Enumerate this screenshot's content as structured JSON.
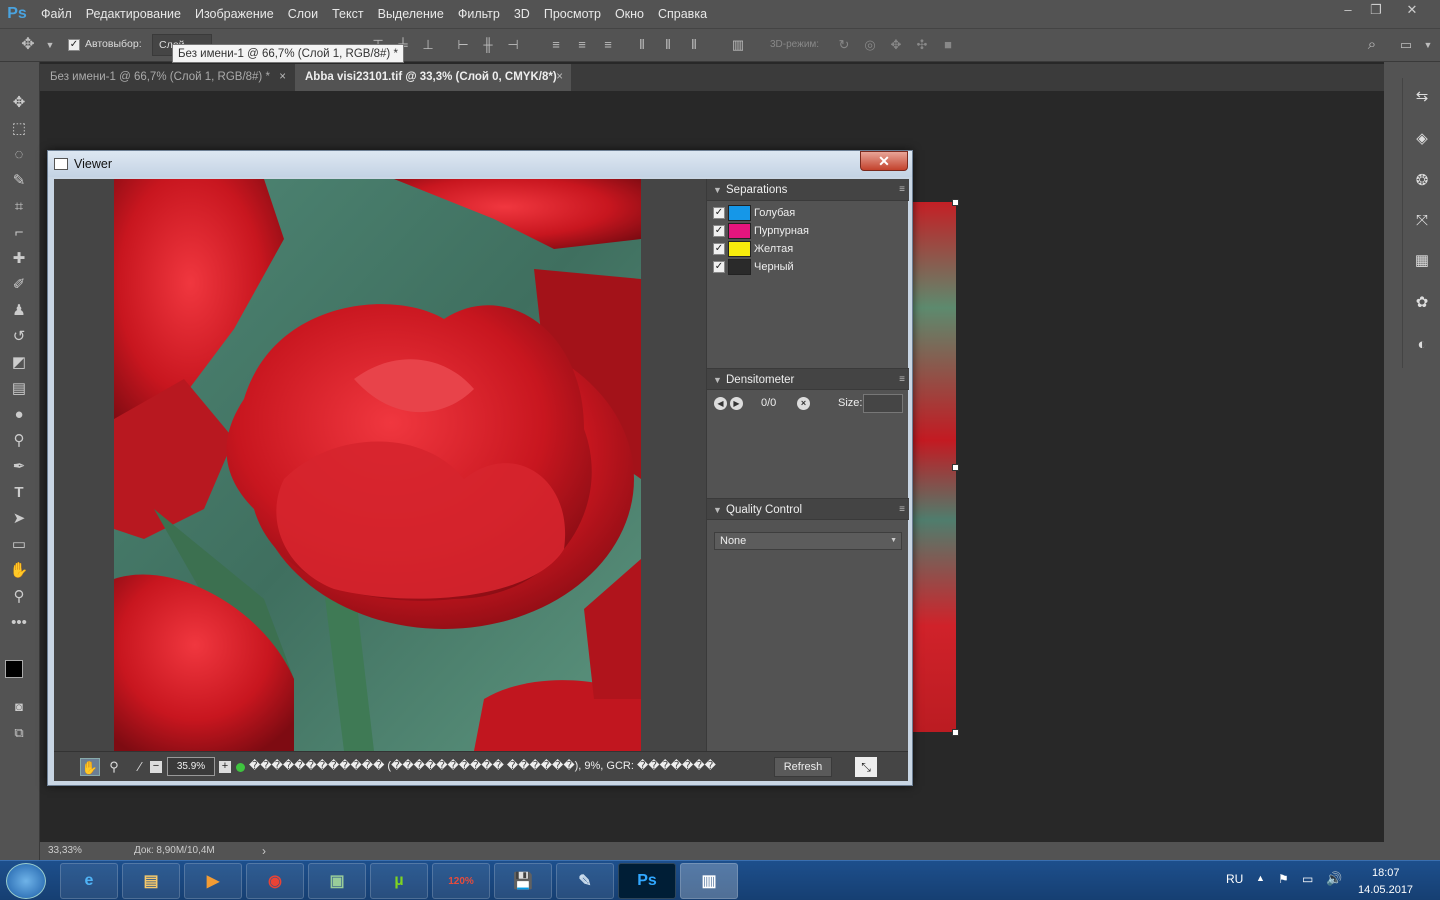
{
  "app": {
    "logo": "Ps"
  },
  "menu": [
    "Файл",
    "Редактирование",
    "Изображение",
    "Слои",
    "Текст",
    "Выделение",
    "Фильтр",
    "3D",
    "Просмотр",
    "Окно",
    "Справка"
  ],
  "window_controls": {
    "minimize": "–",
    "restore": "❐",
    "close": "✕"
  },
  "options": {
    "autoselect_label": "Автовыбор:",
    "autoselect_value": "Слой",
    "mode_3d_label": "3D-режим:"
  },
  "tooltip": "Без имени-1 @ 66,7% (Слой 1, RGB/8#) *",
  "tabs": [
    {
      "label": "Без имени-1 @ 66,7% (Слой 1, RGB/8#) *",
      "close": "×"
    },
    {
      "label": "Abba visi23101.tif @ 33,3% (Слой 0, CMYK/8*)",
      "close": "×"
    }
  ],
  "status": {
    "zoom": "33,33%",
    "doc": "Док: 8,90M/10,4M",
    "arrow": "›"
  },
  "viewer": {
    "title": "Viewer",
    "close": "✕",
    "separations": {
      "title": "Separations",
      "items": [
        {
          "label": "Голубая",
          "color": "#1597e8",
          "checked": "✓"
        },
        {
          "label": "Пурпурная",
          "color": "#e5157e",
          "checked": "✓"
        },
        {
          "label": "Желтая",
          "color": "#f7ec0c",
          "checked": "✓"
        },
        {
          "label": "Черный",
          "color": "#2a2a2a",
          "checked": "✓"
        }
      ]
    },
    "densitometer": {
      "title": "Densitometer",
      "counter": "0/0",
      "size_label": "Size:"
    },
    "quality_control": {
      "title": "Quality Control",
      "selected": "None"
    },
    "bottom": {
      "zoom_value": "35.9%",
      "info_text": "������������ (���������� ������), 9%, GCR: �������",
      "refresh_label": "Refresh"
    }
  },
  "tray": {
    "lang": "RU",
    "time": "18:07",
    "date": "14.05.2017"
  },
  "taskbar_labels": {
    "pdf": "120%"
  }
}
